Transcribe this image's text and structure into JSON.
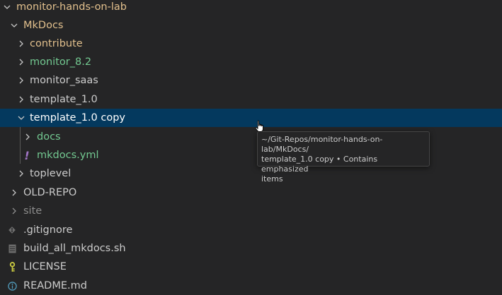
{
  "colors": {
    "folder": "#e2c08d",
    "untracked": "#73c991",
    "default": "#cccccc",
    "ignored": "#8c8c8c",
    "selection": "#04395e"
  },
  "tree": {
    "root": "monitor-hands-on-lab",
    "mkdocs": "MkDocs",
    "contribute": "contribute",
    "monitor_82": "monitor_8.2",
    "monitor_saas": "monitor_saas",
    "template_10": "template_1.0",
    "template_10_copy": "template_1.0 copy",
    "docs": "docs",
    "mkdocs_yml": "mkdocs.yml",
    "toplevel": "toplevel",
    "old_repo": "OLD-REPO",
    "site": "site",
    "gitignore": ".gitignore",
    "build_script": "build_all_mkdocs.sh",
    "license": "LICENSE",
    "readme": "README.md"
  },
  "icons": {
    "yml": "!",
    "gitignore": "git-diamond-icon",
    "shell": "file-lines-icon",
    "license": "key-icon",
    "readme": "info-icon"
  },
  "tooltip": {
    "path": "~/Git-Repos/monitor-hands-on-lab/MkDocs/",
    "detail": "template_1.0 copy • Contains emphasized",
    "detail2": "items"
  }
}
